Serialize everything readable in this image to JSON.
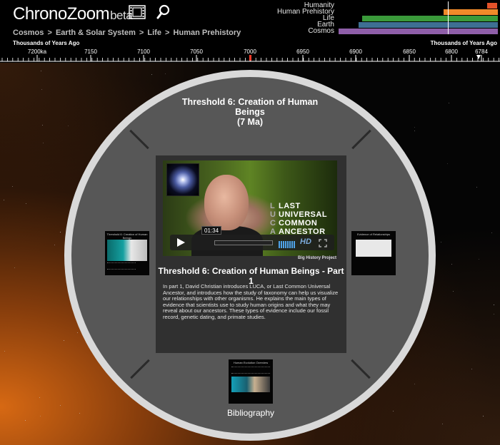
{
  "app": {
    "logo_main": "ChronoZoom",
    "logo_beta": "beta"
  },
  "breadcrumb": [
    {
      "label": "Cosmos"
    },
    {
      "label": "Earth & Solar System"
    },
    {
      "label": "Life"
    },
    {
      "label": "Human Prehistory"
    }
  ],
  "breadcrumb_separator": ">",
  "minimap": {
    "rows": [
      {
        "label": "Humanity",
        "color": "#e4522a"
      },
      {
        "label": "Human Prehistory",
        "color": "#f08a2a"
      },
      {
        "label": "Life",
        "color": "#3a9a3a"
      },
      {
        "label": "Earth",
        "color": "#3e6f93"
      },
      {
        "label": "Cosmos",
        "color": "#8e5ea8"
      }
    ]
  },
  "ruler": {
    "title_left": "Thousands of Years Ago",
    "title_right": "Thousands of Years Ago",
    "ticks": [
      "7200ka",
      "7150",
      "7100",
      "7050",
      "7000",
      "6950",
      "6900",
      "6850",
      "6800",
      "6784"
    ],
    "marker_value": "7000"
  },
  "exhibit": {
    "title_line1": "Threshold 6: Creation of Human",
    "title_line2": "Beings",
    "title_line3": "(7 Ma)"
  },
  "content": {
    "video_time": "01:34",
    "video_hd": "HD",
    "luca_lines": [
      {
        "letter": "L",
        "word": "LAST"
      },
      {
        "letter": "U",
        "word": "UNIVERSAL"
      },
      {
        "letter": "C",
        "word": "COMMON"
      },
      {
        "letter": "A",
        "word": "ANCESTOR"
      }
    ],
    "credit": "Big History Project",
    "title": "Threshold 6: Creation of Human Beings - Part 1",
    "description": "In part 1, David Christian introduces LUCA, or Last Common Universal Ancestor, and introduces how the study of taxonomy can help us visualize our relationships with other organisms. He explains the main types of evidence that scientists use to study human origins and what they may reveal about our ancestors. These types of evidence include our fossil record, genetic dating, and primate studies."
  },
  "thumbnails": {
    "left_title": "Threshold 6: Creation of Human Beings",
    "right_title": "Evidence of Relationships",
    "bottom_title": "Human Evolution Overview"
  },
  "bibliography_label": "Bibliography"
}
